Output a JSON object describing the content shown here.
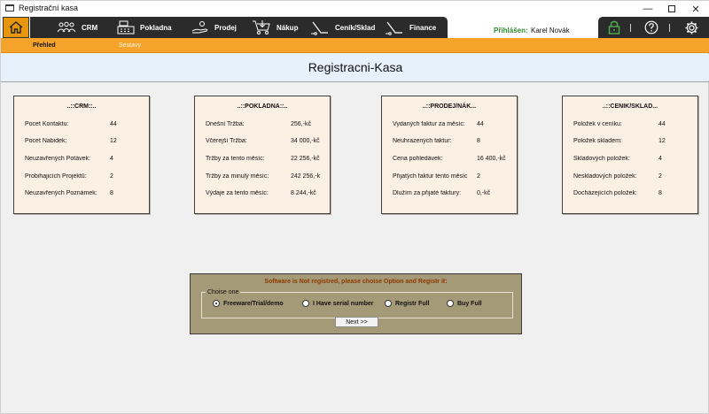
{
  "window": {
    "title": "Registrační kasa"
  },
  "nav": {
    "items": [
      {
        "label": "CRM"
      },
      {
        "label": "Pokladna"
      },
      {
        "label": "Prodej"
      },
      {
        "label": "Nákup"
      },
      {
        "label": "Ceník/Sklad"
      },
      {
        "label": "Finance"
      }
    ],
    "user_label": "Přihlášen:",
    "user_name": "Karel Novák"
  },
  "subnav": {
    "active": "Přehled",
    "inactive": "Sestavy"
  },
  "header": {
    "title": "Registracni-Kasa"
  },
  "panels": [
    {
      "title": "..::CRM::..",
      "rows": [
        {
          "label": "Pocet Kontaktu:",
          "value": "44"
        },
        {
          "label": "Pocet Nabidek:",
          "value": "12"
        },
        {
          "label": "Neuzavřených Potávek:",
          "value": "4"
        },
        {
          "label": "Probihajicích Projektů:",
          "value": "2"
        },
        {
          "label": "Neuzavřených Poznámek:",
          "value": "8"
        }
      ]
    },
    {
      "title": "..::POKLADNA::..",
      "rows": [
        {
          "label": "Dnešní Tržba:",
          "value": "256,-kč"
        },
        {
          "label": "Včerejší Tržba:",
          "value": "34 000,-kč"
        },
        {
          "label": "Tržby za tento měsíc:",
          "value": "22 256,-kč"
        },
        {
          "label": "Tržby za minulý měsíc:",
          "value": "242 256,-k"
        },
        {
          "label": "Výdaje za tento měsíc:",
          "value": "8 244,-kč"
        }
      ]
    },
    {
      "title": "..::PRODEJ/NÁK...",
      "rows": [
        {
          "label": "Vydaných faktur za měsíc:",
          "value": "44"
        },
        {
          "label": "Neuhrazených faktur:",
          "value": "8"
        },
        {
          "label": "Cena pohledávek:",
          "value": "16 400,-kč"
        },
        {
          "label": "Přijatých faktur tento měsíc",
          "value": "2"
        },
        {
          "label": "Dlužím za přijaté faktury:",
          "value": "0,-kč"
        }
      ]
    },
    {
      "title": "..::CENIK/SKLAD...",
      "rows": [
        {
          "label": "Položek v ceníku:",
          "value": "44"
        },
        {
          "label": "Položek skladem:",
          "value": "12"
        },
        {
          "label": "Skladových položek:",
          "value": "4"
        },
        {
          "label": "Neskladových položek:",
          "value": "2"
        },
        {
          "label": "Docházejících položek:",
          "value": "8"
        }
      ]
    }
  ],
  "registration": {
    "message": "Software is Not registred, please choise Option and Registr it:",
    "group_label": "Choise one",
    "options": [
      {
        "label": "Freeware/Trial/demo",
        "selected": true
      },
      {
        "label": "I Have serial number",
        "selected": false
      },
      {
        "label": "Registr Full",
        "selected": false
      },
      {
        "label": "Buy Full",
        "selected": false
      }
    ],
    "next_label": "Next >>"
  },
  "colors": {
    "accent": "#f5a32a",
    "nav_bar": "#2b2b2b",
    "panel_bg": "#fbf0e4",
    "header_bg": "#e6f1fb",
    "dialog_bg": "#a59a78",
    "warning_text": "#8b3a00",
    "user_label": "#2e8b2e"
  },
  "icons": [
    "app-window-icon",
    "home-icon",
    "crm-people-icon",
    "cash-register-icon",
    "hand-coin-icon",
    "cart-icon",
    "scale-icon",
    "finance-icon",
    "lock-icon",
    "help-icon",
    "settings-gear-icon"
  ]
}
